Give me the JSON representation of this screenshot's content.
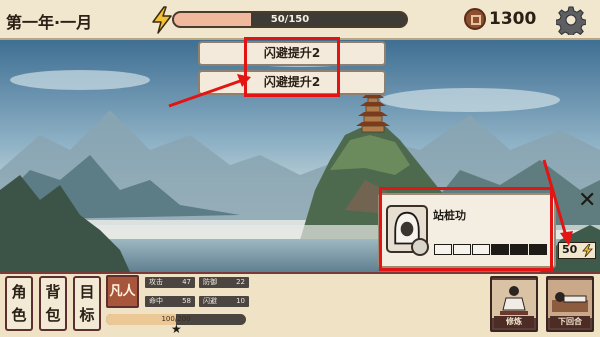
{
  "header": {
    "date": "第一年·一月",
    "energy_text": "50/150",
    "energy_fraction": 0.3333,
    "coins": "1300"
  },
  "options": [
    {
      "label": "闪避提升2"
    },
    {
      "label": "闪避提升2"
    }
  ],
  "skill_card": {
    "name": "站桩功",
    "progress_total": 6,
    "progress_filled": 3,
    "cost": "50"
  },
  "bottom": {
    "tabs": [
      {
        "top": "角",
        "bottom": "色"
      },
      {
        "top": "背",
        "bottom": "包"
      },
      {
        "top": "目",
        "bottom": "标"
      }
    ],
    "realm": "凡人",
    "stats": [
      {
        "label": "攻击",
        "value": "47"
      },
      {
        "label": "防御",
        "value": "22"
      },
      {
        "label": "命中",
        "value": "58"
      },
      {
        "label": "闪避",
        "value": "10"
      }
    ],
    "xp_text": "100/200",
    "xp_fraction": 0.5,
    "star": "★",
    "actions": [
      {
        "label": "修炼"
      },
      {
        "label": "下回合"
      }
    ]
  },
  "colors": {
    "highlight": "#e21414",
    "energy_fill": "#f0b89d",
    "realm_badge": "#a8563b"
  },
  "icons": {
    "energy": "lightning-icon",
    "coin": "coin-icon",
    "settings": "gear-icon",
    "close": "close-icon",
    "skill": "hooded-figure-icon",
    "cost": "lightning-icon"
  }
}
